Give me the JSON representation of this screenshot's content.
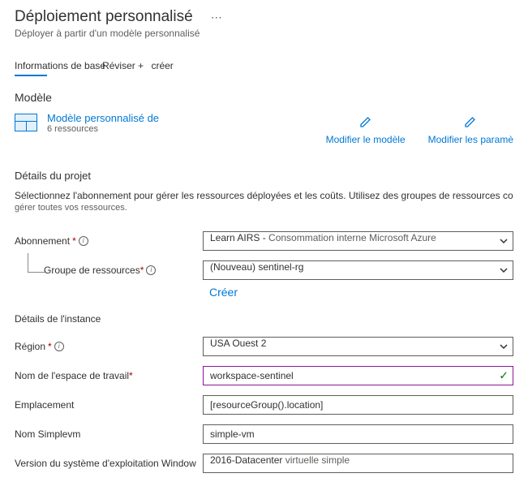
{
  "header": {
    "title": "Déploiement personnalisé",
    "subtitle": "Déployer à partir d'un modèle personnalisé",
    "ellipsis": "⋯"
  },
  "tabs": {
    "basics": "Informations de base",
    "review_prefix": "Réviser +",
    "review_suffix": "créer"
  },
  "template": {
    "heading": "Modèle",
    "link": "Modèle personnalisé de",
    "resources": "6 ressources",
    "edit_template": "Modifier le modèle",
    "edit_params": "Modifier les paramè"
  },
  "project": {
    "heading": "Détails du projet",
    "desc": "Sélectionnez l'abonnement pour gérer les ressources déployées et les coûts. Utilisez des groupes de ressources co",
    "desc_sub": "gérer toutes vos ressources.",
    "subscription_label": "Abonnement",
    "subscription_value_prefix": "Learn AIRS - ",
    "subscription_value_suffix": "Consommation interne Microsoft Azure",
    "rg_label": "Groupe de ressources",
    "rg_value": "(Nouveau) sentinel-rg",
    "create_new": "Créer"
  },
  "instance": {
    "heading": "Détails de l'instance",
    "region_label": "Région",
    "region_value": "USA Ouest 2",
    "workspace_label": "Nom de l'espace de travail",
    "workspace_value": "workspace-sentinel",
    "location_label": "Emplacement",
    "location_value": "[resourceGroup().location]",
    "simplevm_label": "Nom Simplevm",
    "simplevm_value": "simple-vm",
    "os_label_pre": "Version du système d'exploitation Window",
    "os_value": "2016-Datacenter",
    "os_label_suffix": " virtuelle simple"
  }
}
